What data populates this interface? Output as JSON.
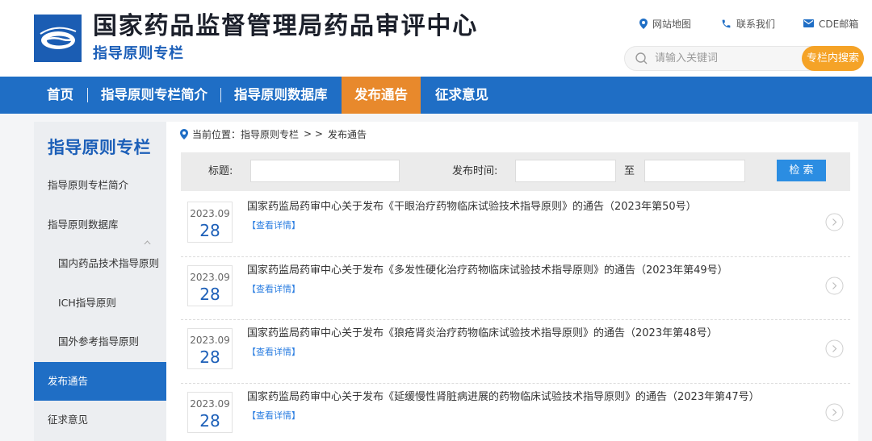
{
  "colors": {
    "primary_blue": "#1f6ec5",
    "title_blue": "#1c5fb8",
    "accent_orange": "#e8892c",
    "search_orange": "#f5a327",
    "link_blue": "#2a7de1",
    "button_blue": "#2b8de2"
  },
  "header": {
    "logo_icon": "cde-logo-icon",
    "title": "国家药品监督管理局药品审评中心",
    "subtitle": "指导原则专栏",
    "top_links": [
      {
        "label": "网站地图",
        "icon": "location-pin-icon"
      },
      {
        "label": "联系我们",
        "icon": "phone-icon"
      },
      {
        "label": "CDE邮箱",
        "icon": "mail-icon"
      }
    ],
    "search": {
      "icon": "search-icon",
      "placeholder": "请输入关键词",
      "value": "",
      "button_label": "专栏内搜索"
    }
  },
  "nav": {
    "items": [
      {
        "label": "首页",
        "active": false
      },
      {
        "label": "指导原则专栏简介",
        "active": false
      },
      {
        "label": "指导原则数据库",
        "active": false
      },
      {
        "label": "发布通告",
        "active": true
      },
      {
        "label": "征求意见",
        "active": false
      }
    ]
  },
  "sidebar": {
    "title": "指导原则专栏",
    "items": [
      {
        "label": "指导原则专栏简介",
        "active": false
      },
      {
        "label": "指导原则数据库",
        "active": false,
        "expanded": true,
        "icon": "chevron-up-icon",
        "children": [
          {
            "label": "国内药品技术指导原则",
            "active": false
          },
          {
            "label": "ICH指导原则",
            "active": false
          },
          {
            "label": "国外参考指导原则",
            "active": false
          }
        ]
      },
      {
        "label": "发布通告",
        "active": true
      },
      {
        "label": "征求意见",
        "active": false
      }
    ]
  },
  "breadcrumb": {
    "icon": "location-pin-icon",
    "label": "当前位置：",
    "crumbs": [
      "指导原则专栏",
      "发布通告"
    ],
    "separator": "> >"
  },
  "filter": {
    "title_label": "标题:",
    "title_value": "",
    "date_label": "发布时间:",
    "date_from_value": "",
    "date_range_separator": "至",
    "date_to_value": "",
    "submit_label": "检 索"
  },
  "notices": [
    {
      "date_year_month": "2023.09",
      "date_day": "28",
      "title": "国家药监局药审中心关于发布《干眼治疗药物临床试验技术指导原则》的通告（2023年第50号）",
      "detail_label": "【查看详情】",
      "icon": "chevron-right-circle-icon"
    },
    {
      "date_year_month": "2023.09",
      "date_day": "28",
      "title": "国家药监局药审中心关于发布《多发性硬化治疗药物临床试验技术指导原则》的通告（2023年第49号）",
      "detail_label": "【查看详情】",
      "icon": "chevron-right-circle-icon"
    },
    {
      "date_year_month": "2023.09",
      "date_day": "28",
      "title": "国家药监局药审中心关于发布《狼疮肾炎治疗药物临床试验技术指导原则》的通告（2023年第48号）",
      "detail_label": "【查看详情】",
      "icon": "chevron-right-circle-icon"
    },
    {
      "date_year_month": "2023.09",
      "date_day": "28",
      "title": "国家药监局药审中心关于发布《延缓慢性肾脏病进展的药物临床试验技术指导原则》的通告（2023年第47号）",
      "detail_label": "【查看详情】",
      "icon": "chevron-right-circle-icon"
    }
  ]
}
